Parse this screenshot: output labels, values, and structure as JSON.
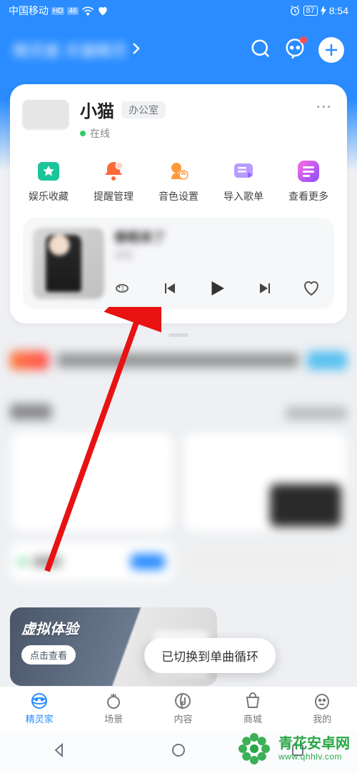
{
  "status": {
    "carrier": "中国移动",
    "hd": "HD",
    "net": "46",
    "battery_pct": "87",
    "time": "8:54"
  },
  "header": {
    "title_blurred": "精灵屋 天猫精灵"
  },
  "device": {
    "name": "小猫",
    "room": "办公室",
    "status_text": "在线"
  },
  "quick_actions": [
    {
      "label": "娱乐收藏",
      "icon": "star"
    },
    {
      "label": "提醒管理",
      "icon": "bell"
    },
    {
      "label": "音色设置",
      "icon": "voice"
    },
    {
      "label": "导入歌单",
      "icon": "playlist"
    },
    {
      "label": "查看更多",
      "icon": "more"
    }
  ],
  "player": {
    "title_blurred": "春眠来了",
    "subtitle_blurred": "未知"
  },
  "vx": {
    "title": "虚拟体验",
    "cta": "点击查看"
  },
  "toast": "已切换到单曲循环",
  "tabs": [
    {
      "label": "精灵家",
      "icon": "home",
      "active": true
    },
    {
      "label": "场景",
      "icon": "scene",
      "active": false
    },
    {
      "label": "内容",
      "icon": "content",
      "active": false
    },
    {
      "label": "商城",
      "icon": "shop",
      "active": false
    },
    {
      "label": "我的",
      "icon": "me",
      "active": false
    }
  ],
  "watermark": {
    "brand": "青花安卓网",
    "url": "www.qhhlv.com"
  }
}
